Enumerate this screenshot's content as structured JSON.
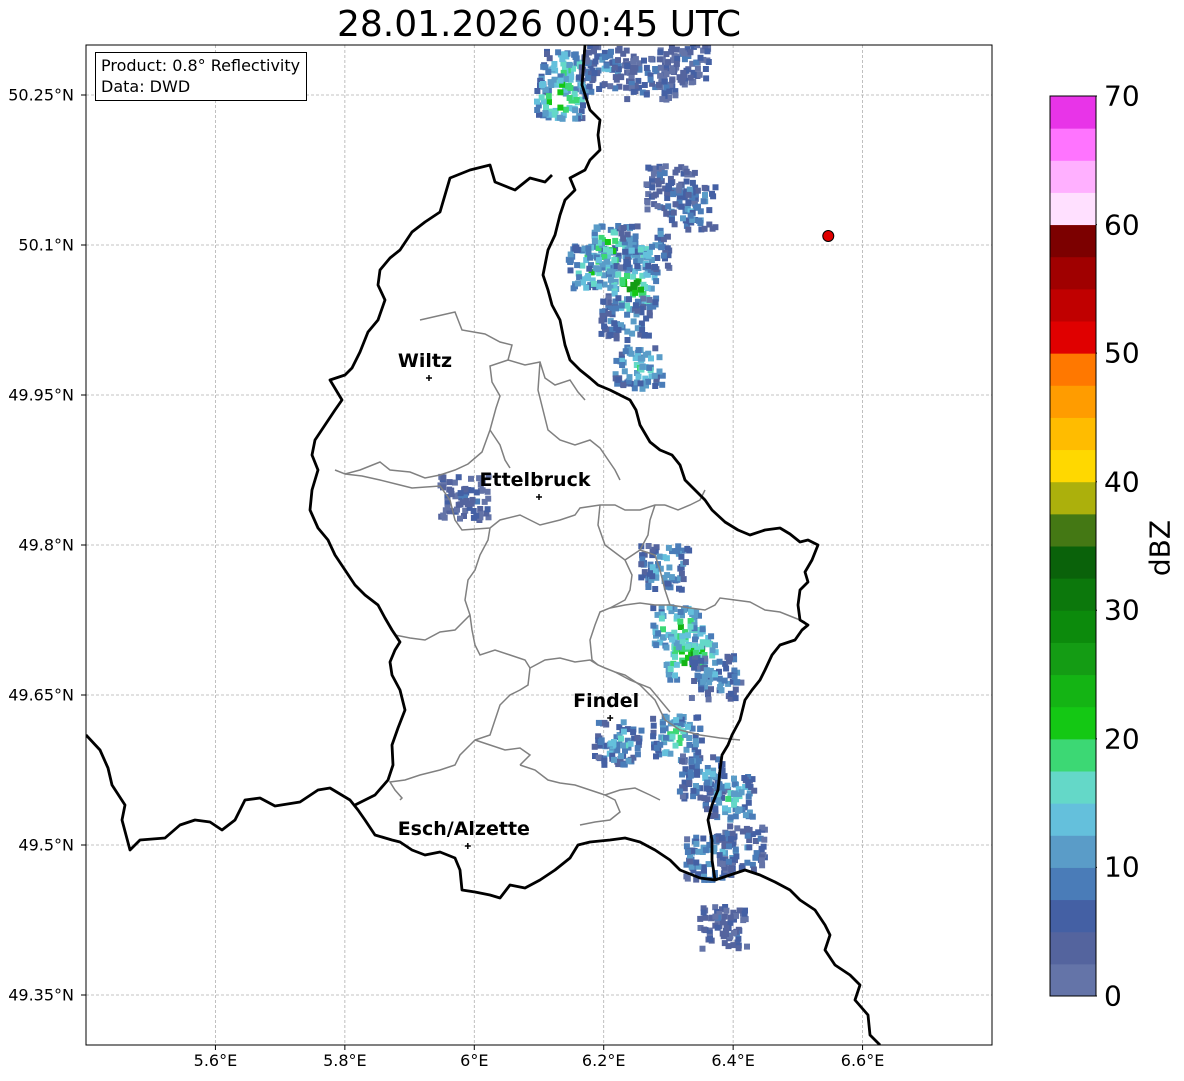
{
  "title": "28.01.2026 00:45 UTC",
  "info": {
    "product": "Product: 0.8° Reflectivity",
    "data": "Data: DWD"
  },
  "axes": {
    "lon_range": [
      5.4,
      6.8
    ],
    "lat_range": [
      49.3,
      50.3
    ],
    "lon_ticks": [
      {
        "value": 5.6,
        "label": "5.6°E"
      },
      {
        "value": 5.8,
        "label": "5.8°E"
      },
      {
        "value": 6.0,
        "label": "6°E"
      },
      {
        "value": 6.2,
        "label": "6.2°E"
      },
      {
        "value": 6.4,
        "label": "6.4°E"
      },
      {
        "value": 6.6,
        "label": "6.6°E"
      }
    ],
    "lat_ticks": [
      {
        "value": 50.25,
        "label": "50.25°N"
      },
      {
        "value": 50.1,
        "label": "50.1°N"
      },
      {
        "value": 49.95,
        "label": "49.95°N"
      },
      {
        "value": 49.8,
        "label": "49.8°N"
      },
      {
        "value": 49.65,
        "label": "49.65°N"
      },
      {
        "value": 49.5,
        "label": "49.5°N"
      },
      {
        "value": 49.35,
        "label": "49.35°N"
      }
    ]
  },
  "cities": [
    {
      "name": "Wiltz",
      "lon": 5.93,
      "lat": 49.967
    },
    {
      "name": "Ettelbruck",
      "lon": 6.1,
      "lat": 49.848
    },
    {
      "name": "Findel",
      "lon": 6.21,
      "lat": 49.627
    },
    {
      "name": "Esch/Alzette",
      "lon": 5.99,
      "lat": 49.499
    }
  ],
  "radar_site": {
    "lon": 6.547,
    "lat": 50.109,
    "color": "#e00000"
  },
  "colorbar": {
    "label": "dBZ",
    "min": 0,
    "max": 70,
    "step": 2.5,
    "ticks": [
      "0",
      "10",
      "20",
      "30",
      "40",
      "50",
      "60",
      "70"
    ],
    "colors": [
      "#6474a8",
      "#54649e",
      "#4460a4",
      "#4a7cb8",
      "#5a9cc8",
      "#64c0dc",
      "#64d8c8",
      "#3cd874",
      "#14c814",
      "#14b414",
      "#149c14",
      "#0c8a0c",
      "#0c780c",
      "#0a620a",
      "#447814",
      "#acb00c",
      "#ffd800",
      "#ffbc00",
      "#ff9c00",
      "#ff7800",
      "#e00000",
      "#c00000",
      "#a00000",
      "#7c0000",
      "#ffe0ff",
      "#ffb0ff",
      "#ff74ff",
      "#e834e8"
    ]
  },
  "reflectivity_cells": [
    {
      "lon": 6.14,
      "lat": 50.275,
      "dbz": 18
    },
    {
      "lon": 6.2,
      "lat": 50.28,
      "dbz": 10
    },
    {
      "lon": 6.27,
      "lat": 50.27,
      "dbz": 8
    },
    {
      "lon": 6.32,
      "lat": 50.285,
      "dbz": 6
    },
    {
      "lon": 6.13,
      "lat": 50.25,
      "dbz": 24
    },
    {
      "lon": 6.3,
      "lat": 50.16,
      "dbz": 8
    },
    {
      "lon": 6.33,
      "lat": 50.14,
      "dbz": 12
    },
    {
      "lon": 6.18,
      "lat": 50.08,
      "dbz": 20
    },
    {
      "lon": 6.21,
      "lat": 50.1,
      "dbz": 22
    },
    {
      "lon": 6.24,
      "lat": 50.06,
      "dbz": 26
    },
    {
      "lon": 6.26,
      "lat": 50.1,
      "dbz": 14
    },
    {
      "lon": 6.23,
      "lat": 50.03,
      "dbz": 12
    },
    {
      "lon": 6.25,
      "lat": 49.98,
      "dbz": 16
    },
    {
      "lon": 5.98,
      "lat": 49.85,
      "dbz": 6
    },
    {
      "lon": 6.29,
      "lat": 49.78,
      "dbz": 14
    },
    {
      "lon": 6.31,
      "lat": 49.72,
      "dbz": 22
    },
    {
      "lon": 6.33,
      "lat": 49.69,
      "dbz": 26
    },
    {
      "lon": 6.37,
      "lat": 49.67,
      "dbz": 12
    },
    {
      "lon": 6.22,
      "lat": 49.605,
      "dbz": 14
    },
    {
      "lon": 6.31,
      "lat": 49.61,
      "dbz": 18
    },
    {
      "lon": 6.35,
      "lat": 49.57,
      "dbz": 12
    },
    {
      "lon": 6.39,
      "lat": 49.55,
      "dbz": 16
    },
    {
      "lon": 6.36,
      "lat": 49.49,
      "dbz": 14
    },
    {
      "lon": 6.41,
      "lat": 49.5,
      "dbz": 10
    },
    {
      "lon": 6.38,
      "lat": 49.42,
      "dbz": 6
    }
  ]
}
